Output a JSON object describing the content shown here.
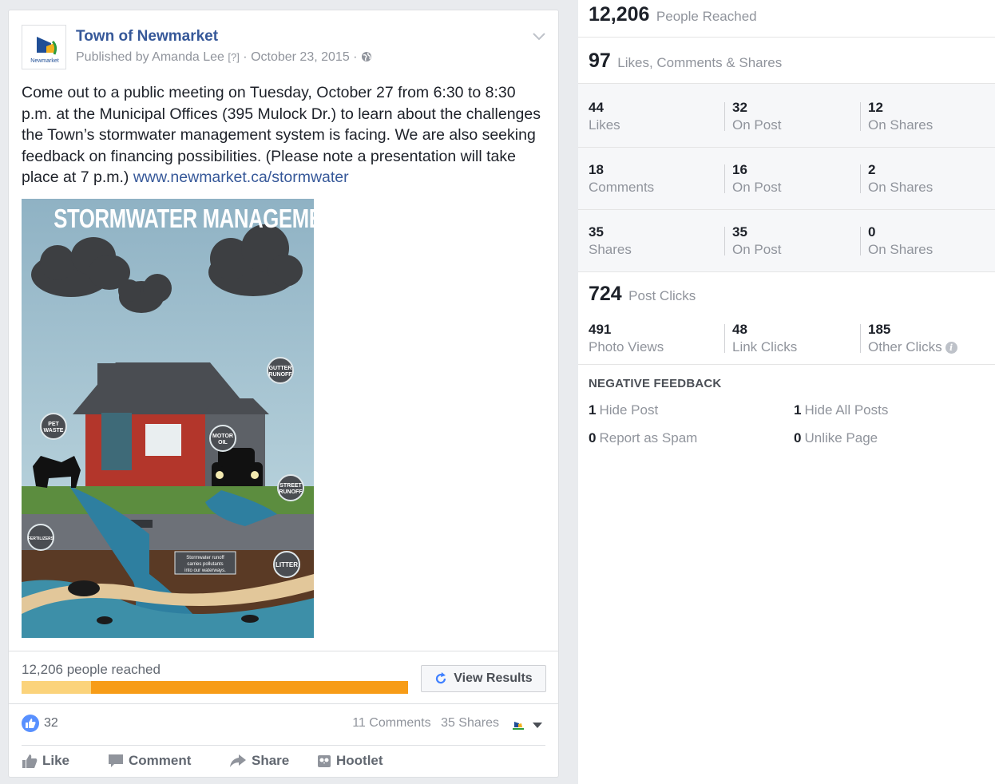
{
  "post": {
    "page_name": "Town of Newmarket",
    "logo_text": "Newmarket",
    "published_by": "Published by Amanda Lee",
    "help_marker": "[?]",
    "date": "· October 23, 2015 ·",
    "body_text": "Come out to a public meeting on Tuesday, October 27 from 6:30 to 8:30 p.m. at the Municipal Offices (395 Mulock Dr.) to learn about the challenges the Town’s stormwater management system is facing. We are also seeking feedback on financing possibilities. (Please note a presentation will take place at 7 p.m.)",
    "link": "www.newmarket.ca/stormwater",
    "image": {
      "title": "STORMWATER MANAGEMENT",
      "labels": {
        "gutter": [
          "GUTTER",
          "RUNOFF"
        ],
        "pet": [
          "PET",
          "WASTE"
        ],
        "motor": [
          "MOTOR",
          "OIL"
        ],
        "street": [
          "STREET",
          "RUNOFF"
        ],
        "fertilizers": "FERTILIZERS",
        "litter": "LITTER",
        "caption": [
          "Stormwater runoff",
          "carries pollutants",
          "into our waterways."
        ]
      }
    },
    "reach_text": "12,206 people reached",
    "reach_fill": 0.18,
    "view_results": "View Results",
    "likes": "32",
    "comments": "11 Comments",
    "shares": "35 Shares",
    "actions": {
      "like": "Like",
      "comment": "Comment",
      "share": "Share",
      "hootlet": "Hootlet"
    }
  },
  "insights": {
    "reached": {
      "value": "12,206",
      "label": "People Reached"
    },
    "engagement": {
      "value": "97",
      "label": "Likes, Comments & Shares"
    },
    "rows": [
      {
        "total": "44",
        "total_label": "Likes",
        "post": "32",
        "post_label": "On Post",
        "shares": "12",
        "shares_label": "On Shares"
      },
      {
        "total": "18",
        "total_label": "Comments",
        "post": "16",
        "post_label": "On Post",
        "shares": "2",
        "shares_label": "On Shares"
      },
      {
        "total": "35",
        "total_label": "Shares",
        "post": "35",
        "post_label": "On Post",
        "shares": "0",
        "shares_label": "On Shares"
      }
    ],
    "clicks": {
      "value": "724",
      "label": "Post Clicks"
    },
    "click_stats": [
      {
        "value": "491",
        "label": "Photo Views"
      },
      {
        "value": "48",
        "label": "Link Clicks"
      },
      {
        "value": "185",
        "label": "Other Clicks"
      }
    ],
    "negative": {
      "title": "NEGATIVE FEEDBACK",
      "hide_post": {
        "value": "1",
        "label": "Hide Post"
      },
      "hide_all": {
        "value": "1",
        "label": "Hide All Posts"
      },
      "spam": {
        "value": "0",
        "label": "Report as Spam"
      },
      "unlike": {
        "value": "0",
        "label": "Unlike Page"
      }
    }
  },
  "colors": {
    "link": "#365899",
    "reach_bar": "#f79c17",
    "reach_bar_light": "#fbd37b",
    "like_blue": "#5890ff"
  }
}
